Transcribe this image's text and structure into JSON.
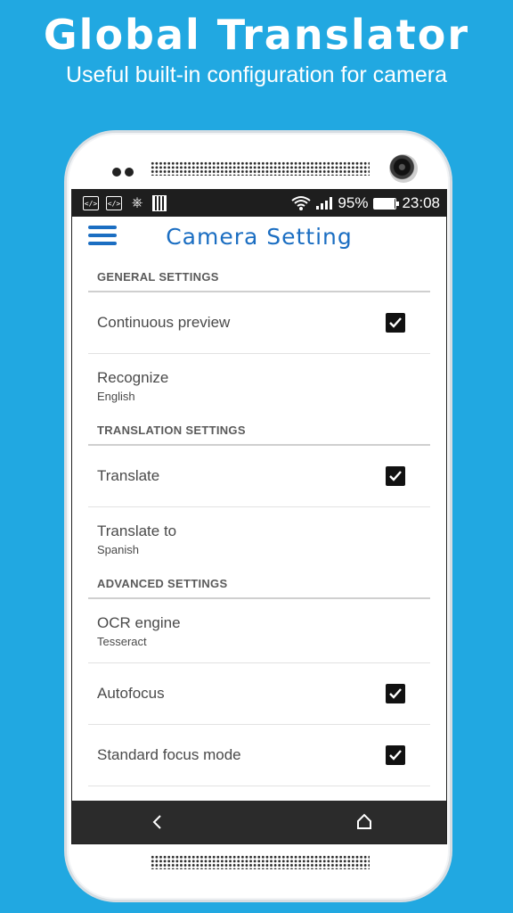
{
  "promo": {
    "title": "Global Translator",
    "subtitle": "Useful built-in configuration for camera"
  },
  "status_bar": {
    "battery": "95%",
    "time": "23:08",
    "icons": [
      "code-icon",
      "code-icon",
      "usb-icon",
      "sd-card-icon",
      "wifi-icon",
      "signal-icon",
      "battery-icon"
    ]
  },
  "app_bar": {
    "title": "Camera Setting",
    "menu_icon": "hamburger-menu-icon"
  },
  "sections": {
    "general": {
      "header": "GENERAL SETTINGS",
      "continuous_preview": {
        "title": "Continuous preview",
        "checked": true
      },
      "recognize": {
        "title": "Recognize",
        "summary": "English"
      }
    },
    "translation": {
      "header": "TRANSLATION SETTINGS",
      "translate": {
        "title": "Translate",
        "checked": true
      },
      "translate_to": {
        "title": "Translate to",
        "summary": "Spanish"
      }
    },
    "advanced": {
      "header": "ADVANCED SETTINGS",
      "ocr_engine": {
        "title": "OCR engine",
        "summary": "Tesseract"
      },
      "autofocus": {
        "title": "Autofocus",
        "checked": true
      },
      "standard_focus": {
        "title": "Standard focus mode",
        "checked": true
      }
    }
  },
  "nav_bar": {
    "icons": [
      "back-icon",
      "home-icon"
    ]
  },
  "colors": {
    "background": "#21a8e1",
    "accent": "#1b6ec2"
  }
}
